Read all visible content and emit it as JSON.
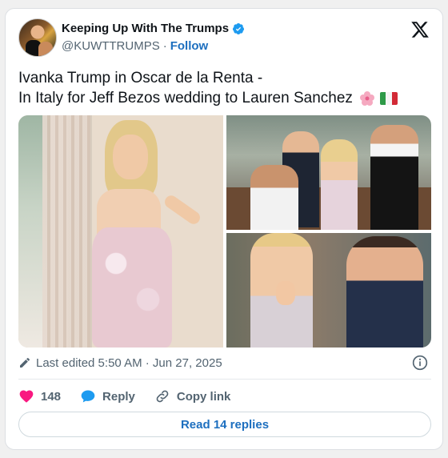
{
  "account": {
    "display_name": "Keeping Up With The Trumps",
    "handle": "@KUWTTRUMPS",
    "separator": "·",
    "follow_label": "Follow"
  },
  "tweet": {
    "line1": "Ivanka Trump in Oscar de la Renta -",
    "line2": "In Italy for Jeff Bezos wedding to Lauren Sanchez",
    "emojis": [
      "cherry-blossom-emoji",
      "italy-flag-emoji"
    ]
  },
  "media": {
    "photo_count": 3
  },
  "meta": {
    "edited_label": "Last edited 5:50 AM · Jun 27, 2025"
  },
  "actions": {
    "like_count": "148",
    "reply_label": "Reply",
    "copy_link_label": "Copy link"
  },
  "read_replies_label": "Read 14 replies",
  "colors": {
    "like": "#f91880",
    "reply": "#1d9bf0",
    "link": "#1d6fbf",
    "verified": "#1d9bf0"
  },
  "icons": [
    "x-logo-icon",
    "verified-badge-icon",
    "pencil-icon",
    "info-icon",
    "heart-icon",
    "reply-bubble-icon",
    "link-icon"
  ]
}
